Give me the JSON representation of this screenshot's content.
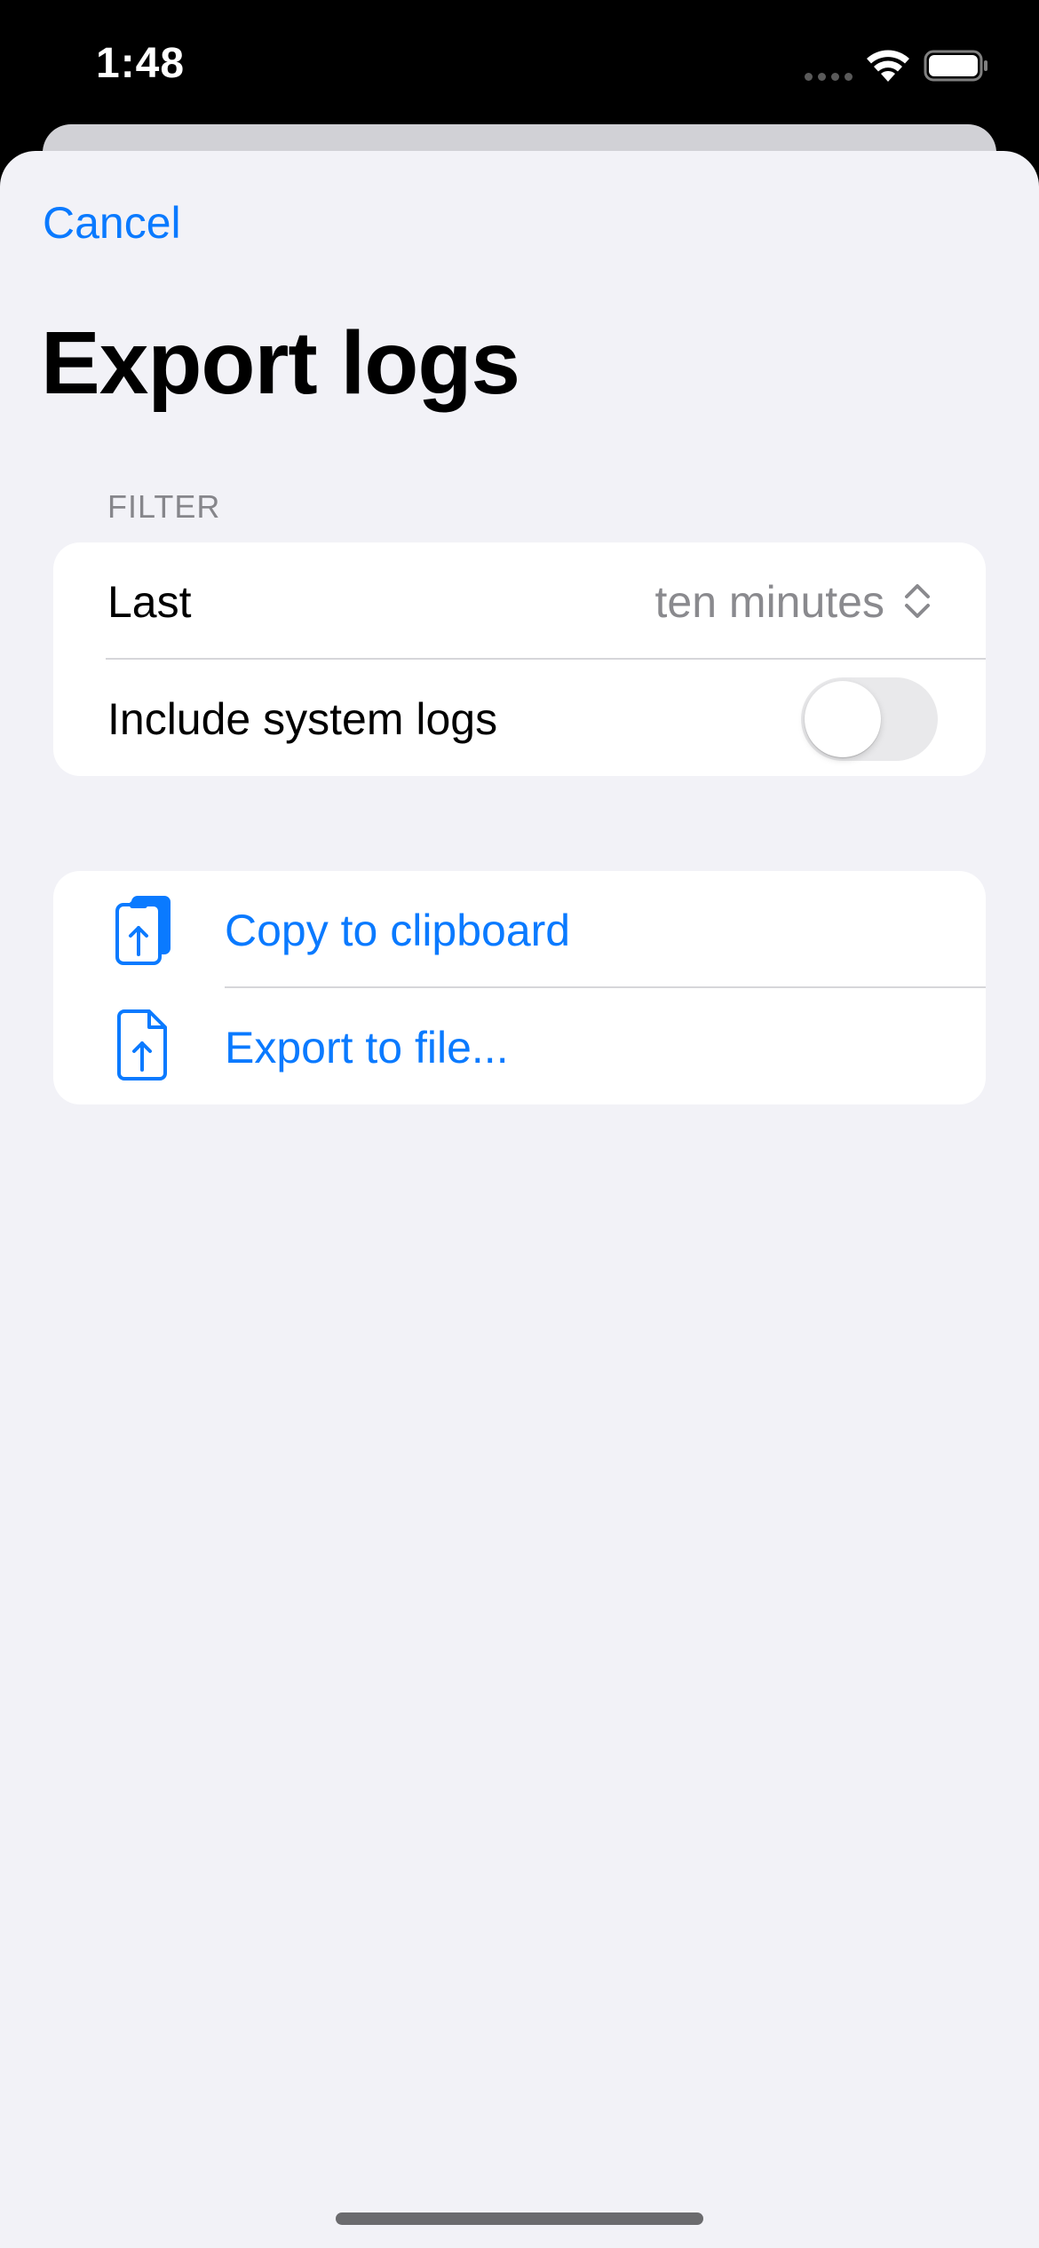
{
  "status_bar": {
    "time": "1:48"
  },
  "sheet": {
    "cancel_label": "Cancel",
    "title": "Export logs"
  },
  "filter_section": {
    "header": "FILTER",
    "last_row": {
      "label": "Last",
      "value": "ten minutes"
    },
    "system_logs_row": {
      "label": "Include system logs",
      "toggle_on": false
    }
  },
  "actions_section": {
    "items": [
      {
        "label": "Copy to clipboard",
        "icon": "clipboard-upload-icon"
      },
      {
        "label": "Export to file...",
        "icon": "document-upload-icon"
      }
    ]
  },
  "colors": {
    "accent": "#0a7aff",
    "background": "#f2f2f7",
    "card": "#ffffff",
    "secondary_text": "#8a8a8e"
  }
}
